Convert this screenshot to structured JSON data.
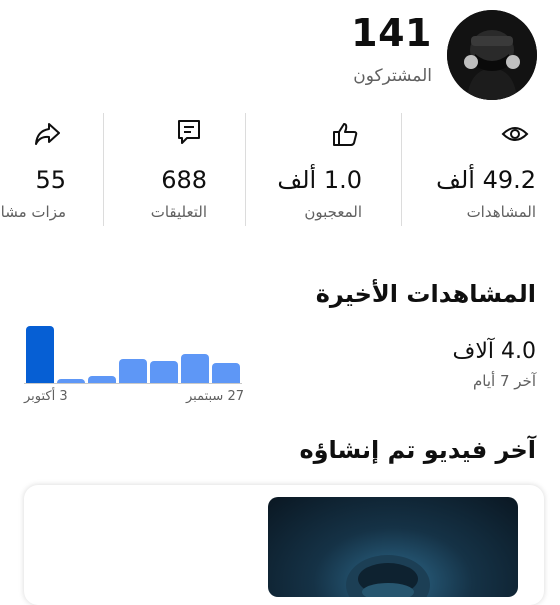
{
  "channel": {
    "subscribers_count": "141",
    "subscribers_label": "المشتركون"
  },
  "stats": [
    {
      "icon": "eye-icon",
      "value": "49.2 ألف",
      "label": "المشاهدات"
    },
    {
      "icon": "thumbs-up-icon",
      "value": "1.0 ألف",
      "label": "المعجبون"
    },
    {
      "icon": "comment-icon",
      "value": "688",
      "label": "التعليقات"
    },
    {
      "icon": "share-icon",
      "value": "55",
      "label": "مزات مشاركة"
    }
  ],
  "recent_views": {
    "title": "المشاهدات الأخيرة",
    "value": "4.0 آلاف",
    "subtitle": "آخر 7 أيام",
    "tick_left": "3 أكتوبر",
    "tick_right": "27 سبتمبر"
  },
  "chart_data": {
    "type": "bar",
    "categories": [
      "",
      "",
      "",
      "",
      "",
      "",
      ""
    ],
    "values": [
      1.3,
      0.1,
      0.15,
      0.55,
      0.5,
      0.65,
      0.45
    ],
    "highlight_index": 0,
    "colors": {
      "highlight": "#065fd4",
      "normal": "#5e97f6"
    },
    "ylim": [
      0,
      1.3
    ]
  },
  "latest_video": {
    "title": "آخر فيديو تم إنشاؤه"
  }
}
